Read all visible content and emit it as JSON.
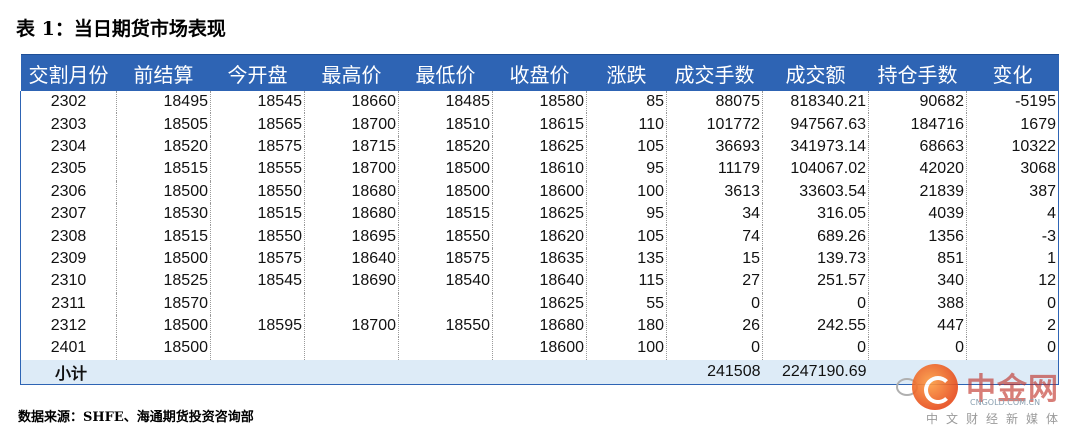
{
  "title": "表 1：当日期货市场表现",
  "source": "数据来源：SHFE、海通期货投资咨询部",
  "watermark": {
    "name": "中金网",
    "url": "CNGOLD.COM.CN",
    "sub": "中文财经新媒体"
  },
  "columns": [
    "交割月份",
    "前结算",
    "今开盘",
    "最高价",
    "最低价",
    "收盘价",
    "涨跌",
    "成交手数",
    "成交额",
    "持仓手数",
    "变化"
  ],
  "rows": [
    [
      "2302",
      "18495",
      "18545",
      "18660",
      "18485",
      "18580",
      "85",
      "88075",
      "818340.21",
      "90682",
      "-5195"
    ],
    [
      "2303",
      "18505",
      "18565",
      "18700",
      "18510",
      "18615",
      "110",
      "101772",
      "947567.63",
      "184716",
      "1679"
    ],
    [
      "2304",
      "18520",
      "18575",
      "18715",
      "18520",
      "18625",
      "105",
      "36693",
      "341973.14",
      "68663",
      "10322"
    ],
    [
      "2305",
      "18515",
      "18555",
      "18700",
      "18500",
      "18610",
      "95",
      "11179",
      "104067.02",
      "42020",
      "3068"
    ],
    [
      "2306",
      "18500",
      "18550",
      "18680",
      "18500",
      "18600",
      "100",
      "3613",
      "33603.54",
      "21839",
      "387"
    ],
    [
      "2307",
      "18530",
      "18515",
      "18680",
      "18515",
      "18625",
      "95",
      "34",
      "316.05",
      "4039",
      "4"
    ],
    [
      "2308",
      "18515",
      "18550",
      "18695",
      "18550",
      "18620",
      "105",
      "74",
      "689.26",
      "1356",
      "-3"
    ],
    [
      "2309",
      "18500",
      "18575",
      "18640",
      "18575",
      "18635",
      "135",
      "15",
      "139.73",
      "851",
      "1"
    ],
    [
      "2310",
      "18525",
      "18545",
      "18690",
      "18540",
      "18640",
      "115",
      "27",
      "251.57",
      "340",
      "12"
    ],
    [
      "2311",
      "18570",
      "",
      "",
      "",
      "18625",
      "55",
      "0",
      "0",
      "388",
      "0"
    ],
    [
      "2312",
      "18500",
      "18595",
      "18700",
      "18550",
      "18680",
      "180",
      "26",
      "242.55",
      "447",
      "2"
    ],
    [
      "2401",
      "18500",
      "",
      "",
      "",
      "18600",
      "100",
      "0",
      "0",
      "0",
      "0"
    ]
  ],
  "total": {
    "label": "小计",
    "volume": "241508",
    "turnover": "2247190.69"
  },
  "colors": {
    "header_bg": "#2e64b4",
    "total_bg": "#ddebf7"
  }
}
